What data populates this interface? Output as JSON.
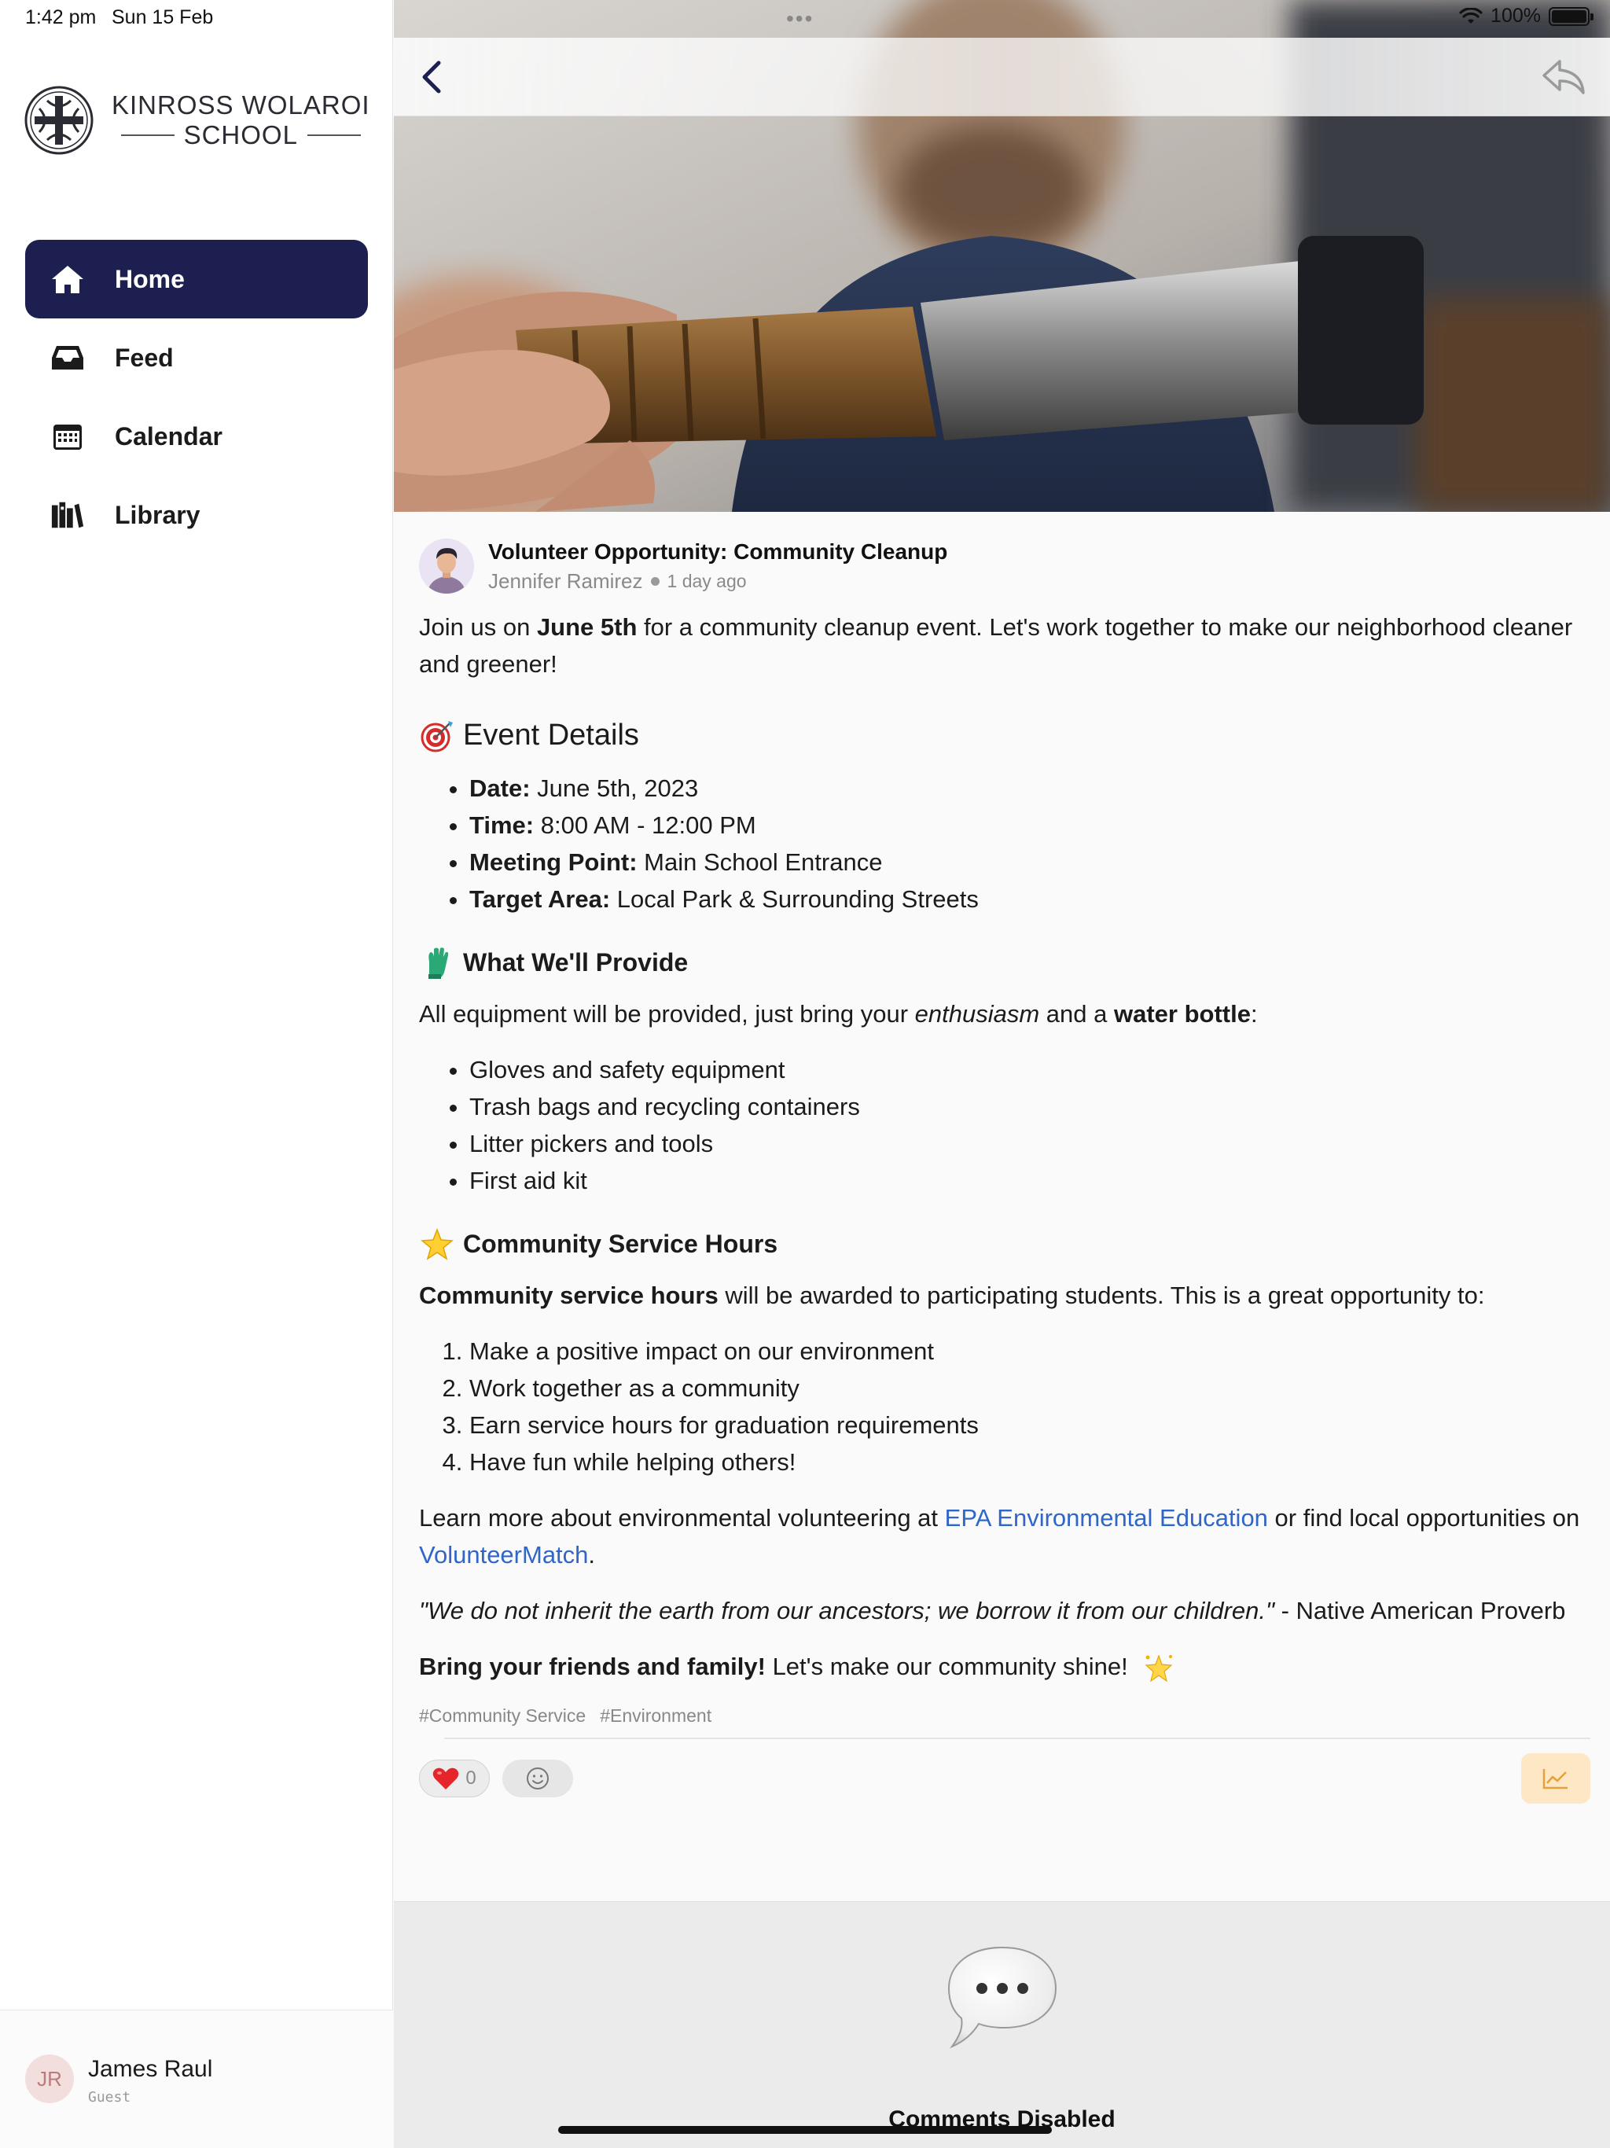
{
  "status": {
    "time": "1:42 pm",
    "date": "Sun 15 Feb",
    "dots": "•••",
    "battery": "100%"
  },
  "school": {
    "name_line1": "KINROSS WOLAROI",
    "name_line2": "SCHOOL"
  },
  "nav": {
    "items": [
      {
        "label": "Home",
        "icon": "home-icon",
        "active": true
      },
      {
        "label": "Feed",
        "icon": "inbox-icon",
        "active": false
      },
      {
        "label": "Calendar",
        "icon": "calendar-icon",
        "active": false
      },
      {
        "label": "Library",
        "icon": "books-icon",
        "active": false
      }
    ]
  },
  "user": {
    "initials": "JR",
    "name": "James Raul",
    "role": "Guest"
  },
  "post": {
    "title": "Volunteer Opportunity: Community Cleanup",
    "author": "Jennifer Ramirez",
    "time": "1 day ago",
    "intro_pre": "Join us on ",
    "intro_bold": "June 5th",
    "intro_post": " for a community cleanup event. Let's work together to make our neighborhood cleaner and greener!",
    "event_heading": "Event Details",
    "event_details": [
      {
        "label": "Date:",
        "value": " June 5th, 2023"
      },
      {
        "label": "Time:",
        "value": " 8:00 AM - 12:00 PM"
      },
      {
        "label": "Meeting Point:",
        "value": " Main School Entrance"
      },
      {
        "label": "Target Area:",
        "value": " Local Park & Surrounding Streets"
      }
    ],
    "provide_heading": "What We'll Provide",
    "provide_pre": "All equipment will be provided, just bring your ",
    "provide_italic": "enthusiasm",
    "provide_mid": " and a ",
    "provide_bold": "water bottle",
    "provide_post": ":",
    "provide_items": [
      "Gloves and safety equipment",
      "Trash bags and recycling containers",
      "Litter pickers and tools",
      "First aid kit"
    ],
    "hours_heading": "Community Service Hours",
    "hours_bold": "Community service hours",
    "hours_post": " will be awarded to participating students. This is a great opportunity to:",
    "hours_items": [
      "Make a positive impact on our environment",
      "Work together as a community",
      "Earn service hours for graduation requirements",
      "Have fun while helping others!"
    ],
    "learn_pre": "Learn more about environmental volunteering at ",
    "learn_link1": "EPA Environmental Education",
    "learn_mid": " or find local opportunities on ",
    "learn_link2": "VolunteerMatch",
    "learn_post": ".",
    "quote_italic": "\"We do not inherit the earth from our ancestors; we borrow it from our children.\"",
    "quote_post": " - Native American Proverb",
    "closing_bold": "Bring your friends and family!",
    "closing_post": " Let's make our community shine!",
    "tags": [
      "#Community Service",
      "#Environment"
    ],
    "heart_count": "0"
  },
  "comments": {
    "label": "Comments Disabled"
  },
  "colors": {
    "nav_active": "#1c1f4f",
    "link": "#2f66c8",
    "stats_bg": "#fde7c5"
  }
}
